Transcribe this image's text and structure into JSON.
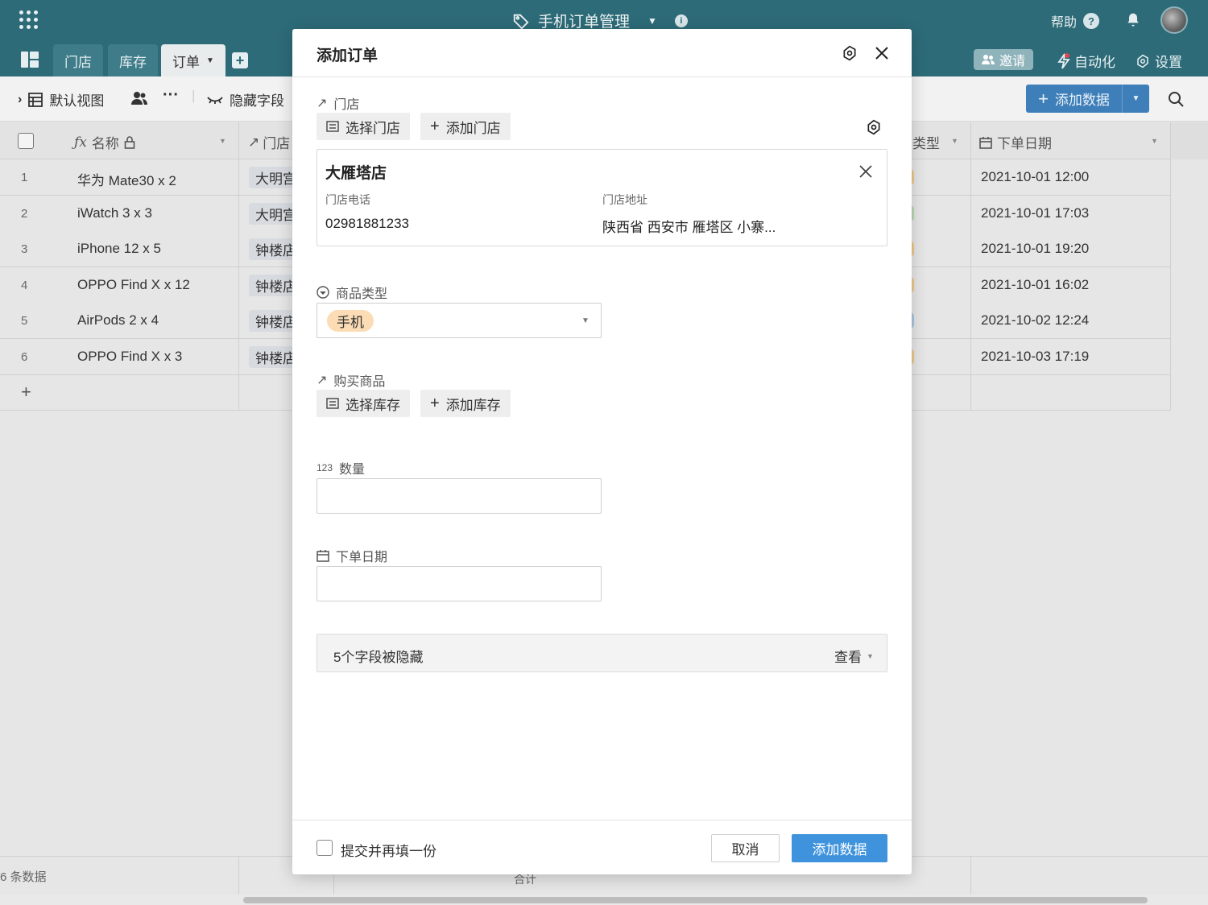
{
  "app": {
    "title": "手机订单管理",
    "help_label": "帮助",
    "tabs": [
      {
        "label": "门店"
      },
      {
        "label": "库存"
      },
      {
        "label": "订单"
      }
    ],
    "invite_label": "邀请",
    "automation_label": "自动化",
    "settings_label": "设置"
  },
  "toolbar": {
    "view_label": "默认视图",
    "hidden_fields_label": "隐藏字段",
    "add_data_label": "添加数据"
  },
  "grid": {
    "columns": {
      "name": "名称",
      "store": "门店",
      "type": "类型",
      "date": "下单日期"
    },
    "rows": [
      {
        "idx": "1",
        "name": "华为 Mate30 x 2",
        "store": "大明宫",
        "date": "2021-10-01 12:00",
        "dot_color": "#f0c98c"
      },
      {
        "idx": "2",
        "name": "iWatch 3 x 3",
        "store": "大明宫",
        "date": "2021-10-01 17:03",
        "dot_color": "#b9d8b0"
      },
      {
        "idx": "3",
        "name": "iPhone 12 x 5",
        "store": "钟楼店",
        "date": "2021-10-01 19:20",
        "dot_color": "#f0c98c"
      },
      {
        "idx": "4",
        "name": "OPPO Find X x 12",
        "store": "钟楼店",
        "date": "2021-10-01 16:02",
        "dot_color": "#f0c98c"
      },
      {
        "idx": "5",
        "name": "AirPods 2 x 4",
        "store": "钟楼店",
        "date": "2021-10-02 12:24",
        "dot_color": "#a9c7e3"
      },
      {
        "idx": "6",
        "name": "OPPO Find X x 3",
        "store": "钟楼店",
        "date": "2021-10-03 17:19",
        "dot_color": "#f0c98c"
      }
    ],
    "footer_count": "6 条数据",
    "footer_sum": "合计"
  },
  "modal": {
    "title": "添加订单",
    "store_field": {
      "label": "门店",
      "select_btn": "选择门店",
      "add_btn": "添加门店",
      "card": {
        "name": "大雁塔店",
        "phone_label": "门店电话",
        "phone": "02981881233",
        "address_label": "门店地址",
        "address": "陕西省 西安市 雁塔区 小寨..."
      }
    },
    "type_field": {
      "label": "商品类型",
      "value": "手机"
    },
    "goods_field": {
      "label": "购买商品",
      "select_btn": "选择库存",
      "add_btn": "添加库存"
    },
    "qty_field": {
      "label": "数量",
      "icon_text": "123"
    },
    "date_field": {
      "label": "下单日期"
    },
    "hidden_notice": "5个字段被隐藏",
    "view_label": "查看",
    "repeat_label": "提交并再填一份",
    "cancel_label": "取消",
    "submit_label": "添加数据"
  },
  "colors": {
    "topbar": "#2d6b78",
    "primary_blue": "#3f93dc",
    "pill": "#fbdcb5"
  }
}
